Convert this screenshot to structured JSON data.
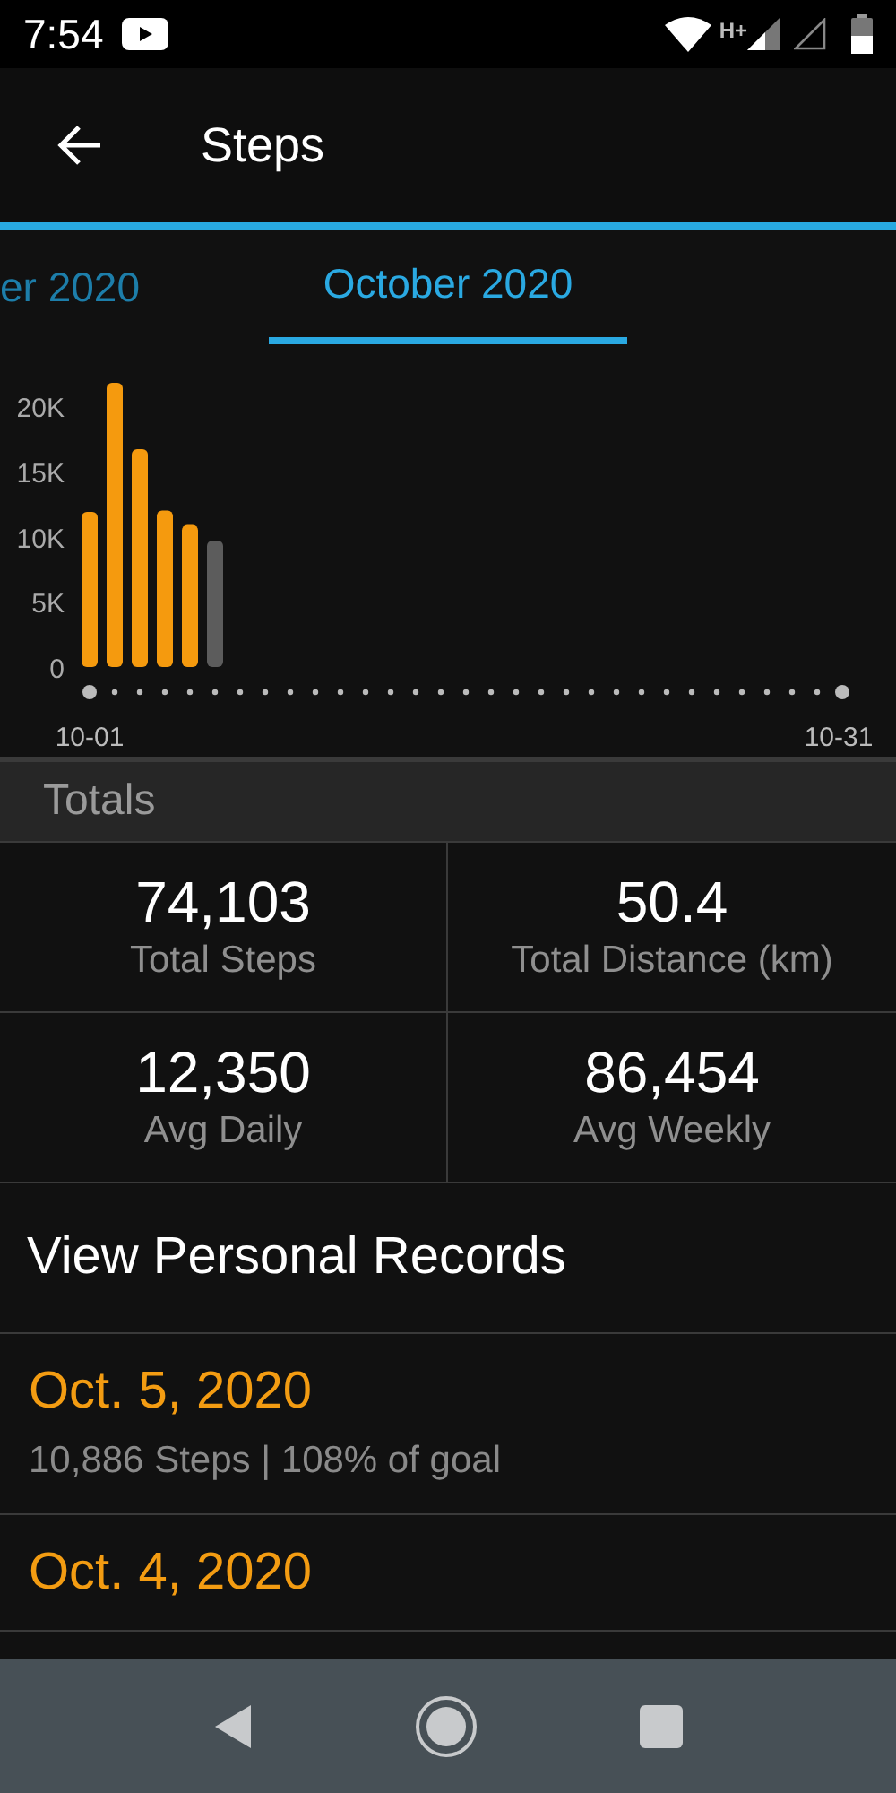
{
  "status_bar": {
    "time": "7:54",
    "network": "H+"
  },
  "header": {
    "title": "Steps"
  },
  "tabs": [
    {
      "label": "er 2020",
      "selected": false
    },
    {
      "label": "October 2020",
      "selected": true
    }
  ],
  "chart_data": {
    "type": "bar",
    "stacked": true,
    "categories": [
      "10-01",
      null,
      null,
      null,
      null,
      null,
      null,
      null,
      null,
      null,
      null,
      null,
      null,
      null,
      null,
      null,
      null,
      null,
      null,
      null,
      null,
      null,
      null,
      null,
      null,
      null,
      null,
      null,
      null,
      null,
      "10-31"
    ],
    "series": [
      {
        "color": "#f59a0e",
        "values": [
          11900,
          21800,
          16700,
          12000,
          10900,
          null,
          null,
          null,
          null,
          null,
          null,
          null,
          null,
          null,
          null,
          null,
          null,
          null,
          null,
          null,
          null,
          null,
          null,
          null,
          null,
          null,
          null,
          null,
          null,
          null,
          null
        ]
      },
      {
        "color": "#5c5c5c",
        "values": [
          null,
          null,
          null,
          null,
          null,
          9700,
          null,
          null,
          null,
          null,
          null,
          null,
          null,
          null,
          null,
          null,
          null,
          null,
          null,
          null,
          null,
          null,
          null,
          null,
          null,
          null,
          null,
          null,
          null,
          null,
          null
        ]
      }
    ],
    "ylim": [
      0,
      22000
    ],
    "yticks": [
      {
        "value": 0,
        "label": "0"
      },
      {
        "value": 5000,
        "label": "5K"
      },
      {
        "value": 10000,
        "label": "10K"
      },
      {
        "value": 15000,
        "label": "15K"
      },
      {
        "value": 20000,
        "label": "20K"
      }
    ]
  },
  "totals": {
    "heading": "Totals",
    "stats": [
      {
        "value": "74,103",
        "label": "Total Steps"
      },
      {
        "value": "50.4",
        "label": "Total Distance (km)"
      },
      {
        "value": "12,350",
        "label": "Avg Daily"
      },
      {
        "value": "86,454",
        "label": "Avg Weekly"
      }
    ]
  },
  "records": {
    "heading": "View Personal Records",
    "items": [
      {
        "date": "Oct. 5, 2020",
        "detail": "10,886 Steps | 108% of goal"
      },
      {
        "date": "Oct. 4, 2020"
      }
    ]
  }
}
